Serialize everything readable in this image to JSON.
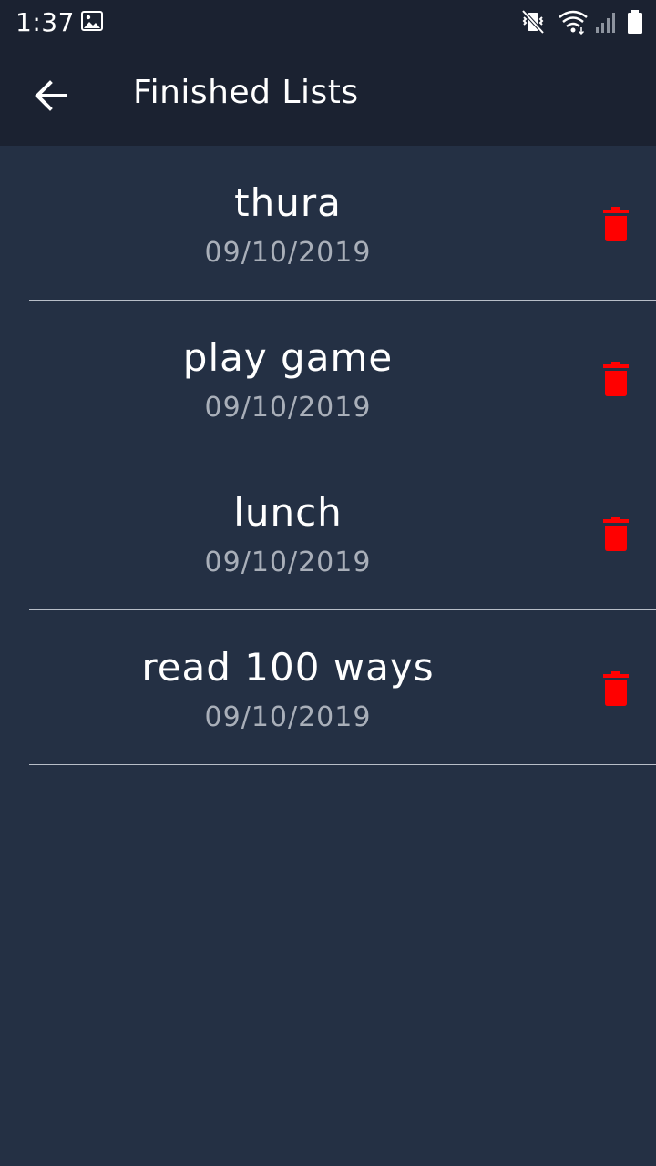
{
  "status_bar": {
    "time": "1:37",
    "icons": [
      "image-icon",
      "mute-vibrate-icon",
      "wifi-icon",
      "signal-icon",
      "battery-icon"
    ]
  },
  "app_bar": {
    "title": "Finished Lists",
    "back_icon": "arrow-left-icon"
  },
  "colors": {
    "background": "#243044",
    "app_bar": "#1b2231",
    "delete": "#ff0000",
    "date_text": "#a9afb9"
  },
  "items": [
    {
      "title": "thura",
      "date": "09/10/2019",
      "delete_icon": "trash-icon"
    },
    {
      "title": "play game",
      "date": "09/10/2019",
      "delete_icon": "trash-icon"
    },
    {
      "title": "lunch",
      "date": "09/10/2019",
      "delete_icon": "trash-icon"
    },
    {
      "title": "read 100 ways",
      "date": "09/10/2019",
      "delete_icon": "trash-icon"
    }
  ]
}
